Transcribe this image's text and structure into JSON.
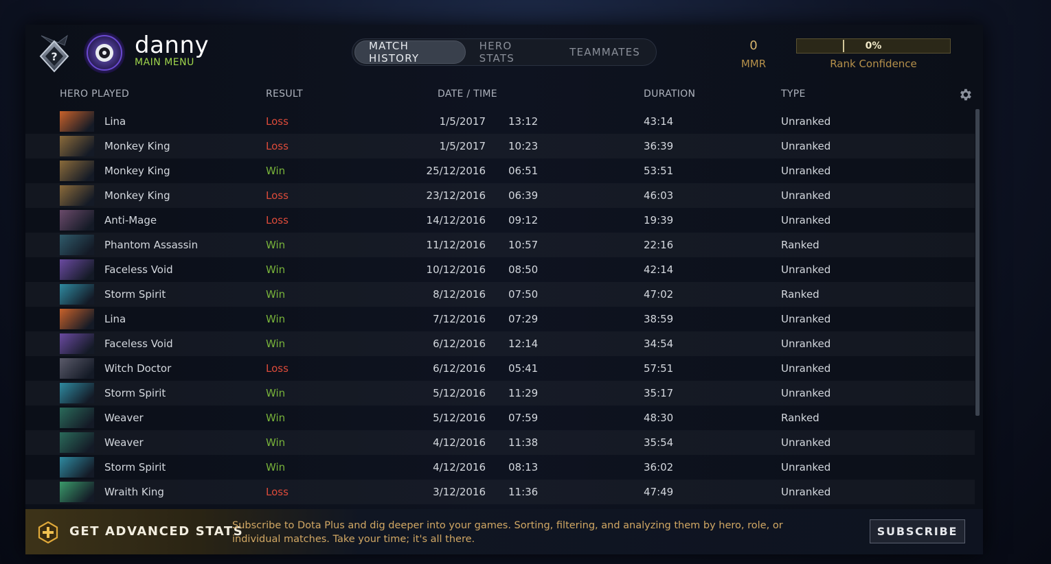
{
  "header": {
    "username": "danny",
    "subtitle": "MAIN MENU",
    "rank_badge_glyph": "?",
    "tabs": [
      {
        "label": "MATCH HISTORY",
        "active": true
      },
      {
        "label": "HERO STATS",
        "active": false
      },
      {
        "label": "TEAMMATES",
        "active": false
      }
    ],
    "mmr_value": "0",
    "mmr_label": "MMR",
    "rank_confidence_pct": "0%",
    "rank_confidence_label": "Rank Confidence"
  },
  "table": {
    "columns": {
      "hero": "HERO PLAYED",
      "result": "RESULT",
      "datetime": "DATE / TIME",
      "duration": "DURATION",
      "type": "TYPE"
    },
    "settings_icon": "gear-icon",
    "rows": [
      {
        "hero": "Lina",
        "result": "Loss",
        "date": "1/5/2017",
        "time": "13:12",
        "duration": "43:14",
        "type": "Unranked",
        "portrait": "#c8612a"
      },
      {
        "hero": "Monkey King",
        "result": "Loss",
        "date": "1/5/2017",
        "time": "10:23",
        "duration": "36:39",
        "type": "Unranked",
        "portrait": "#8a6a3a"
      },
      {
        "hero": "Monkey King",
        "result": "Win",
        "date": "25/12/2016",
        "time": "06:51",
        "duration": "53:51",
        "type": "Unranked",
        "portrait": "#8a6a3a"
      },
      {
        "hero": "Monkey King",
        "result": "Loss",
        "date": "23/12/2016",
        "time": "06:39",
        "duration": "46:03",
        "type": "Unranked",
        "portrait": "#8a6a3a"
      },
      {
        "hero": "Anti-Mage",
        "result": "Loss",
        "date": "14/12/2016",
        "time": "09:12",
        "duration": "19:39",
        "type": "Unranked",
        "portrait": "#6a4a6a"
      },
      {
        "hero": "Phantom Assassin",
        "result": "Win",
        "date": "11/12/2016",
        "time": "10:57",
        "duration": "22:16",
        "type": "Ranked",
        "portrait": "#2f5a6a"
      },
      {
        "hero": "Faceless Void",
        "result": "Win",
        "date": "10/12/2016",
        "time": "08:50",
        "duration": "42:14",
        "type": "Unranked",
        "portrait": "#6a4aa0"
      },
      {
        "hero": "Storm Spirit",
        "result": "Win",
        "date": "8/12/2016",
        "time": "07:50",
        "duration": "47:02",
        "type": "Ranked",
        "portrait": "#2f8aa0"
      },
      {
        "hero": "Lina",
        "result": "Win",
        "date": "7/12/2016",
        "time": "07:29",
        "duration": "38:59",
        "type": "Unranked",
        "portrait": "#c8612a"
      },
      {
        "hero": "Faceless Void",
        "result": "Win",
        "date": "6/12/2016",
        "time": "12:14",
        "duration": "34:54",
        "type": "Unranked",
        "portrait": "#6a4aa0"
      },
      {
        "hero": "Witch Doctor",
        "result": "Loss",
        "date": "6/12/2016",
        "time": "05:41",
        "duration": "57:51",
        "type": "Unranked",
        "portrait": "#5a5a6a"
      },
      {
        "hero": "Storm Spirit",
        "result": "Win",
        "date": "5/12/2016",
        "time": "11:29",
        "duration": "35:17",
        "type": "Unranked",
        "portrait": "#2f8aa0"
      },
      {
        "hero": "Weaver",
        "result": "Win",
        "date": "5/12/2016",
        "time": "07:59",
        "duration": "48:30",
        "type": "Ranked",
        "portrait": "#2a6a5a"
      },
      {
        "hero": "Weaver",
        "result": "Win",
        "date": "4/12/2016",
        "time": "11:38",
        "duration": "35:54",
        "type": "Unranked",
        "portrait": "#2a6a5a"
      },
      {
        "hero": "Storm Spirit",
        "result": "Win",
        "date": "4/12/2016",
        "time": "08:13",
        "duration": "36:02",
        "type": "Unranked",
        "portrait": "#2f8aa0"
      },
      {
        "hero": "Wraith King",
        "result": "Loss",
        "date": "3/12/2016",
        "time": "11:36",
        "duration": "47:49",
        "type": "Unranked",
        "portrait": "#3a9a6a"
      }
    ]
  },
  "footer": {
    "title": "GET ADVANCED STATS",
    "description": "Subscribe to Dota Plus and dig deeper into your games. Sorting, filtering, and analyzing them by hero, role, or individual matches. Take your time; it's all there.",
    "subscribe_label": "SUBSCRIBE",
    "icon": "plus-badge-icon"
  },
  "colors": {
    "win": "#78b33a",
    "loss": "#dd4b3a",
    "gold": "#d2a864",
    "accent_green": "#9fd54c"
  }
}
